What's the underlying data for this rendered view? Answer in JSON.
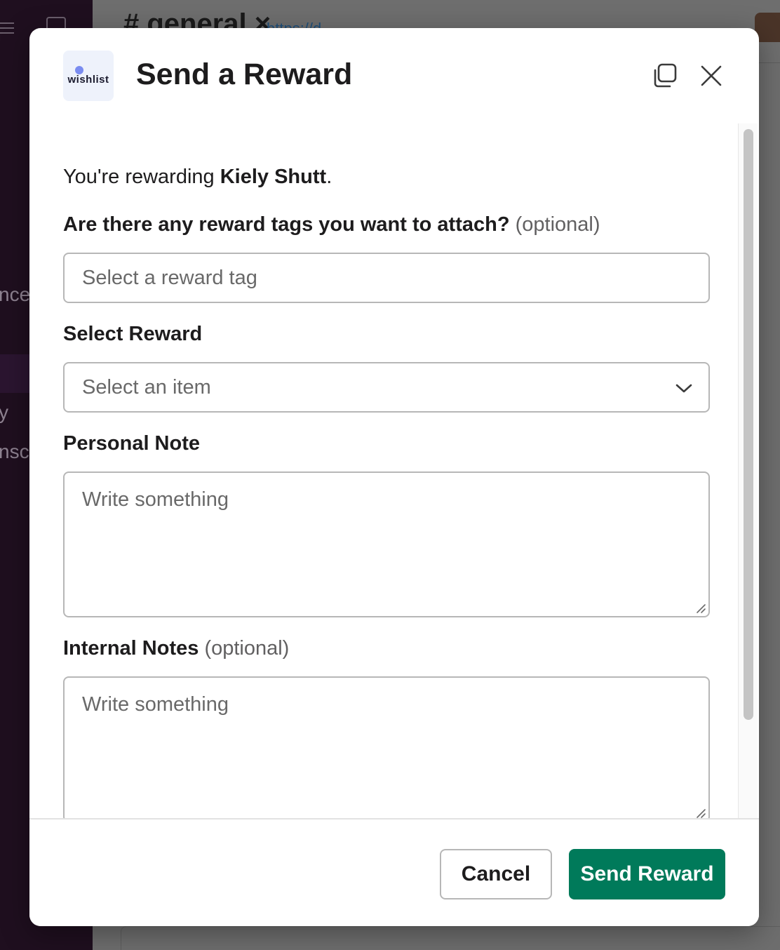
{
  "background": {
    "channel_title": "# general ×",
    "link_text": "https://d...",
    "sidebar_fragments": [
      "nce",
      "y",
      "nsc"
    ]
  },
  "modal": {
    "logo_text": "wishlist",
    "title": "Send a Reward",
    "intro_prefix": "You're rewarding ",
    "recipient": "Kiely Shutt",
    "intro_suffix": ".",
    "fields": {
      "tags": {
        "label": "Are there any reward tags you want to attach?",
        "optional": "(optional)",
        "placeholder": "Select a reward tag"
      },
      "reward": {
        "label": "Select Reward",
        "placeholder": "Select an item"
      },
      "personal_note": {
        "label": "Personal Note",
        "placeholder": "Write something"
      },
      "internal_notes": {
        "label": "Internal Notes",
        "optional": "(optional)",
        "placeholder": "Write something"
      }
    },
    "buttons": {
      "cancel": "Cancel",
      "send": "Send Reward"
    }
  },
  "colors": {
    "primary": "#007a5a",
    "border": "#b7b7b7",
    "text": "#1d1c1d",
    "placeholder": "#696969"
  },
  "icons": {
    "copy": "copy-icon",
    "close": "close-icon",
    "dropdown": "chevron-down-icon",
    "resize": "resize-grip-icon"
  }
}
